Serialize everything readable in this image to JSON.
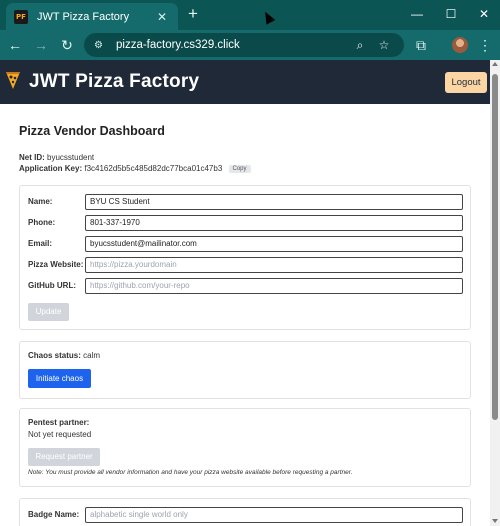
{
  "browser": {
    "tab_title": "JWT Pizza Factory",
    "tab_favicon_text": "PF",
    "tab_close": "✕",
    "new_tab": "+",
    "win_minimize": "—",
    "win_maximize": "☐",
    "win_close": "✕",
    "back": "←",
    "forward": "→",
    "reload": "↻",
    "site_info": "⚙",
    "url": "pizza-factory.cs329.click",
    "zoom_icon": "⌕",
    "bookmark_icon": "☆",
    "extensions_icon": "⧉",
    "menu_icon": "⋮"
  },
  "header": {
    "title": "JWT Pizza Factory",
    "logout_label": "Logout"
  },
  "dashboard": {
    "title": "Pizza Vendor Dashboard",
    "net_id_label": "Net ID:",
    "net_id_value": "byucsstudent",
    "app_key_label": "Application Key:",
    "app_key_value": "f3c4162d5b5c485d82dc77bca01c47b3",
    "copy_label": "Copy"
  },
  "vendor_form": {
    "fields": [
      {
        "label": "Name:",
        "value": "BYU CS Student",
        "placeholder": ""
      },
      {
        "label": "Phone:",
        "value": "801-337-1970",
        "placeholder": ""
      },
      {
        "label": "Email:",
        "value": "byucsstudent@mailinator.com",
        "placeholder": ""
      },
      {
        "label": "Pizza Website:",
        "value": "",
        "placeholder": "https://pizza.yourdomain"
      },
      {
        "label": "GitHub URL:",
        "value": "",
        "placeholder": "https://github.com/your-repo"
      }
    ],
    "update_label": "Update"
  },
  "chaos": {
    "status_label": "Chaos status:",
    "status_value": "calm",
    "button_label": "Initiate chaos"
  },
  "pentest": {
    "title": "Pentest partner:",
    "status": "Not yet requested",
    "button_label": "Request partner",
    "note": "Note: You must provide all vendor information and have your pizza website available before requesting a partner."
  },
  "badge": {
    "label": "Badge Name:",
    "placeholder": "alphabetic single world only"
  },
  "colors": {
    "chrome_bg": "#156b6b",
    "header_bg": "#1f2937",
    "logout_bg": "#fcd5a4",
    "primary": "#1d63ed",
    "disabled": "#d1d5db"
  }
}
